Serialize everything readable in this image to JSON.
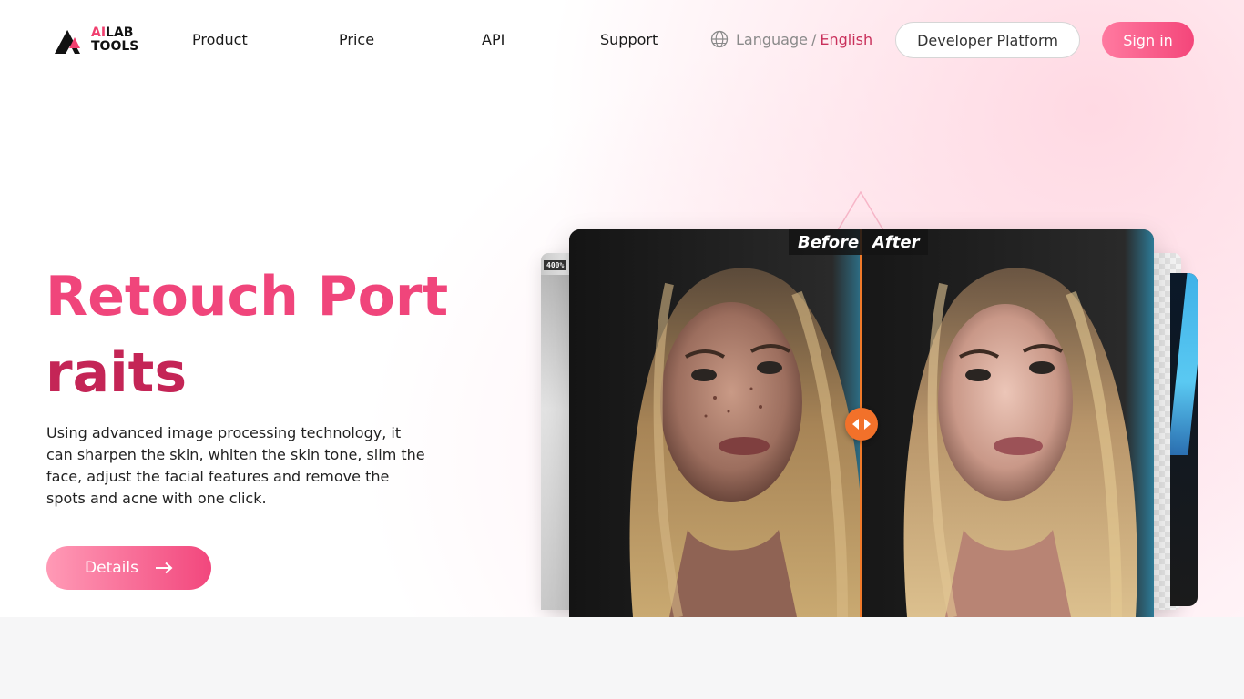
{
  "brand": {
    "logo_line1_accent": "AI",
    "logo_line1_rest": "LAB",
    "logo_line2": "TOOLS"
  },
  "nav": {
    "items": [
      "Product",
      "Price",
      "API",
      "Support"
    ],
    "language_label": "Language",
    "language_separator": "/",
    "language_current": "English",
    "developer_button": "Developer Platform",
    "signin_button": "Sign in"
  },
  "hero": {
    "title_line1": "Retouch Port",
    "title_line2": "raits",
    "description": "Using advanced image processing technology, it can sharpen the skin, whiten the skin tone, slim the face, adjust the facial features and remove the spots and acne with one click.",
    "cta_label": "Details"
  },
  "showcase": {
    "before_label": "Before",
    "after_label": "After",
    "zoom_badge": "400%"
  },
  "colors": {
    "accent": "#f0457b",
    "accent_dark": "#c42556",
    "divider": "#f07a2a",
    "language_current": "#c9305b"
  }
}
